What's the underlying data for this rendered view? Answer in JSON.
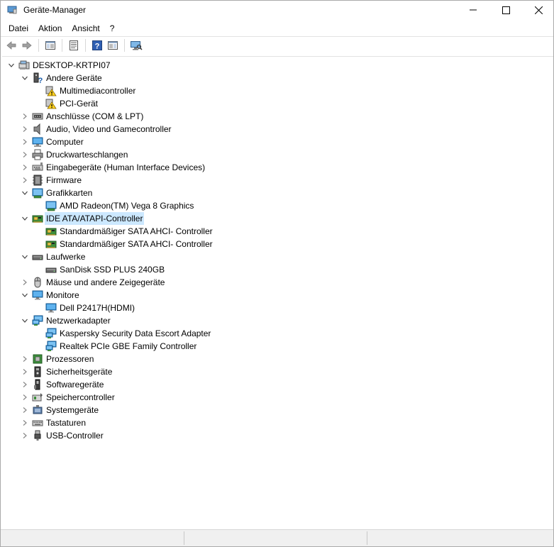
{
  "window": {
    "title": "Geräte-Manager",
    "minimize_icon": "minimize-icon",
    "maximize_icon": "maximize-icon",
    "close_icon": "close-icon"
  },
  "menu": [
    {
      "label": "Datei"
    },
    {
      "label": "Aktion"
    },
    {
      "label": "Ansicht"
    },
    {
      "label": "?"
    }
  ],
  "toolbar": [
    {
      "icon": "back-arrow-icon"
    },
    {
      "icon": "forward-arrow-icon"
    },
    {
      "icon": "show-hide-console-tree-icon"
    },
    {
      "icon": "properties-icon"
    },
    {
      "icon": "help-icon"
    },
    {
      "icon": "action-pane-icon"
    },
    {
      "icon": "scan-hardware-icon"
    }
  ],
  "tree": {
    "root": "DESKTOP-KRTPI07",
    "categories": [
      {
        "label": "Andere Geräte",
        "expanded": true,
        "icon": "other-devices-icon",
        "children": [
          {
            "label": "Multimediacontroller",
            "icon": "warning-device-icon"
          },
          {
            "label": "PCI-Gerät",
            "icon": "warning-device-icon"
          }
        ]
      },
      {
        "label": "Anschlüsse (COM & LPT)",
        "expanded": false,
        "icon": "port-icon"
      },
      {
        "label": "Audio, Video und Gamecontroller",
        "expanded": false,
        "icon": "speaker-icon"
      },
      {
        "label": "Computer",
        "expanded": false,
        "icon": "computer-icon"
      },
      {
        "label": "Druckwarteschlangen",
        "expanded": false,
        "icon": "printer-icon"
      },
      {
        "label": "Eingabegeräte (Human Interface Devices)",
        "expanded": false,
        "icon": "hid-icon"
      },
      {
        "label": "Firmware",
        "expanded": false,
        "icon": "firmware-icon"
      },
      {
        "label": "Grafikkarten",
        "expanded": true,
        "icon": "display-adapter-icon",
        "children": [
          {
            "label": "AMD Radeon(TM) Vega 8 Graphics",
            "icon": "display-adapter-icon"
          }
        ]
      },
      {
        "label": "IDE ATA/ATAPI-Controller",
        "expanded": true,
        "selected": true,
        "icon": "ide-controller-icon",
        "children": [
          {
            "label": "Standardmäßiger SATA AHCI- Controller",
            "icon": "ide-controller-icon"
          },
          {
            "label": "Standardmäßiger SATA AHCI- Controller",
            "icon": "ide-controller-icon"
          }
        ]
      },
      {
        "label": "Laufwerke",
        "expanded": true,
        "icon": "disk-drive-icon",
        "children": [
          {
            "label": "SanDisk SSD PLUS 240GB",
            "icon": "disk-drive-icon"
          }
        ]
      },
      {
        "label": "Mäuse und andere Zeigegeräte",
        "expanded": false,
        "icon": "mouse-icon"
      },
      {
        "label": "Monitore",
        "expanded": true,
        "icon": "monitor-icon",
        "children": [
          {
            "label": "Dell P2417H(HDMI)",
            "icon": "monitor-icon"
          }
        ]
      },
      {
        "label": "Netzwerkadapter",
        "expanded": true,
        "icon": "network-adapter-icon",
        "children": [
          {
            "label": "Kaspersky Security Data Escort Adapter",
            "icon": "network-adapter-icon"
          },
          {
            "label": "Realtek PCIe GBE Family Controller",
            "icon": "network-adapter-icon"
          }
        ]
      },
      {
        "label": "Prozessoren",
        "expanded": false,
        "icon": "processor-icon"
      },
      {
        "label": "Sicherheitsgeräte",
        "expanded": false,
        "icon": "security-device-icon"
      },
      {
        "label": "Softwaregeräte",
        "expanded": false,
        "icon": "software-device-icon"
      },
      {
        "label": "Speichercontroller",
        "expanded": false,
        "icon": "storage-controller-icon"
      },
      {
        "label": "Systemgeräte",
        "expanded": false,
        "icon": "system-device-icon"
      },
      {
        "label": "Tastaturen",
        "expanded": false,
        "icon": "keyboard-icon"
      },
      {
        "label": "USB-Controller",
        "expanded": false,
        "icon": "usb-icon"
      }
    ]
  },
  "colors": {
    "selection": "#cce8ff",
    "statusbar": "#f0f0f0"
  }
}
